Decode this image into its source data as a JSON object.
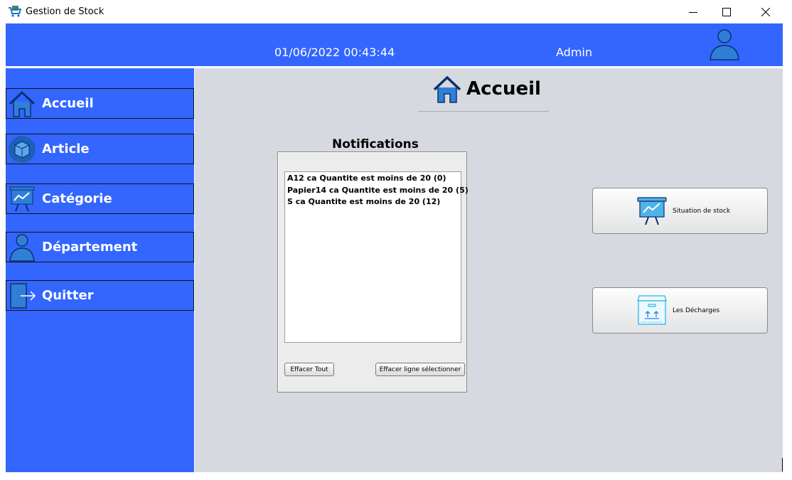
{
  "window": {
    "title": "Gestion de Stock",
    "controls": [
      "minimize",
      "maximize",
      "close"
    ]
  },
  "header": {
    "datetime": "01/06/2022 00:43:44",
    "user": "Admin",
    "avatar_icon": "user-icon",
    "background": "#3366ff"
  },
  "sidebar": {
    "background": "#3366ff",
    "items": [
      {
        "label": "Accueil",
        "icon": "home-icon"
      },
      {
        "label": "Article",
        "icon": "box-icon"
      },
      {
        "label": "Catégorie",
        "icon": "chart-board-icon"
      },
      {
        "label": "Département",
        "icon": "user-icon"
      },
      {
        "label": "Quitter",
        "icon": "exit-door-icon"
      }
    ]
  },
  "main": {
    "page_title": "Accueil",
    "page_icon": "home-icon",
    "background": "#d6d9df",
    "notifications": {
      "title": "Notifications",
      "items": [
        "A12 ca Quantite est moins de 20 (0)",
        "Papier14 ca Quantite est moins de 20 (5)",
        "S ca Quantite est moins de 20 (12)"
      ],
      "clear_all_label": "Effacer Tout",
      "clear_selected_label": "Effacer ligne sélectionner"
    },
    "actions": {
      "stock_situation_label": "Situation de stock",
      "stock_situation_icon": "chart-board-icon",
      "discharges_label": "Les Décharges",
      "discharges_icon": "package-box-icon"
    }
  }
}
